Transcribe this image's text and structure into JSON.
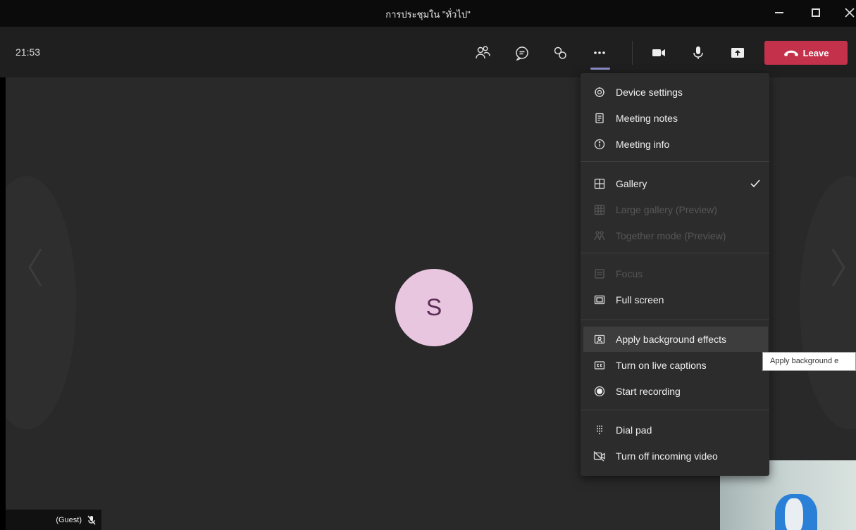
{
  "window": {
    "title": "การประชุมใน \"ทั่วไป\"",
    "controls": {
      "minimize_icon": "minimize-icon",
      "maximize_icon": "maximize-icon",
      "close_icon": "close-icon"
    }
  },
  "toolbar": {
    "time": "21:53",
    "buttons": [
      "participants-icon",
      "chat-icon",
      "reactions-icon",
      "more-actions-icon",
      "camera-icon",
      "microphone-icon",
      "share-tray-icon"
    ],
    "leave_label": "Leave",
    "leave_color": "#c4314b"
  },
  "stage": {
    "avatar_initial": "S",
    "avatar_bg": "#e9c6df",
    "guest_label": "(Guest)"
  },
  "menu": {
    "groups": [
      [
        {
          "label": "Device settings",
          "icon": "gear-icon",
          "enabled": true
        },
        {
          "label": "Meeting notes",
          "icon": "notes-icon",
          "enabled": true
        },
        {
          "label": "Meeting info",
          "icon": "info-icon",
          "enabled": true
        }
      ],
      [
        {
          "label": "Gallery",
          "icon": "gallery-icon",
          "enabled": true,
          "checked": true
        },
        {
          "label": "Large gallery (Preview)",
          "icon": "large-gallery-icon",
          "enabled": false
        },
        {
          "label": "Together mode (Preview)",
          "icon": "together-mode-icon",
          "enabled": false
        }
      ],
      [
        {
          "label": "Focus",
          "icon": "focus-icon",
          "enabled": false
        },
        {
          "label": "Full screen",
          "icon": "full-screen-icon",
          "enabled": true
        }
      ],
      [
        {
          "label": "Apply background effects",
          "icon": "background-effects-icon",
          "enabled": true,
          "highlighted": true
        },
        {
          "label": "Turn on live captions",
          "icon": "captions-icon",
          "enabled": true
        },
        {
          "label": "Start recording",
          "icon": "record-icon",
          "enabled": true
        }
      ],
      [
        {
          "label": "Dial pad",
          "icon": "dial-pad-icon",
          "enabled": true
        },
        {
          "label": "Turn off incoming video",
          "icon": "video-off-icon",
          "enabled": true
        }
      ]
    ]
  },
  "tooltip": {
    "text": "Apply background e"
  }
}
